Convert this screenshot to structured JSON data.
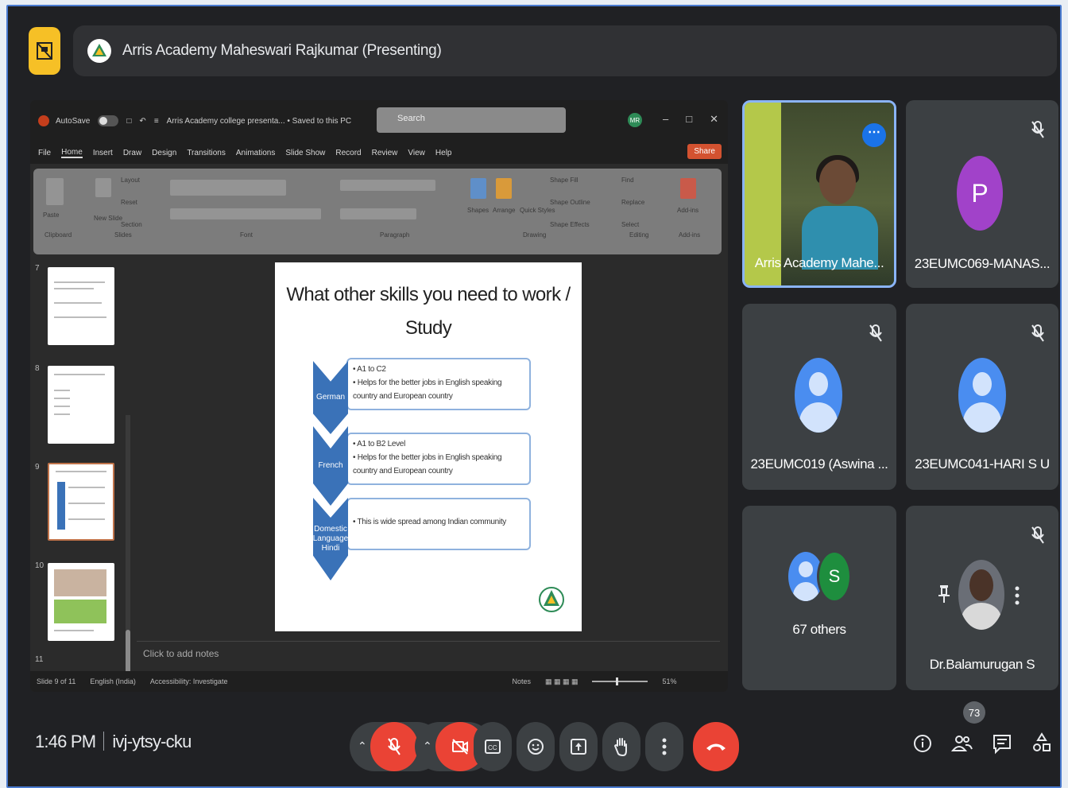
{
  "presenter": {
    "name": "Arris Academy Maheswari Rajkumar (Presenting)"
  },
  "powerpoint": {
    "autosave_label": "AutoSave",
    "autosave_state": "Off",
    "doc_title": "Arris Academy college presenta... • Saved to this PC",
    "search_placeholder": "Search",
    "user_initials": "MR",
    "menu_tabs": [
      "File",
      "Home",
      "Insert",
      "Draw",
      "Design",
      "Transitions",
      "Animations",
      "Slide Show",
      "Record",
      "Review",
      "View",
      "Help"
    ],
    "share_label": "Share",
    "ribbon_groups": [
      "Clipboard",
      "Slides",
      "Font",
      "Paragraph",
      "Drawing",
      "Editing",
      "Add-ins"
    ],
    "ribbon_items": {
      "layout": "Layout",
      "reset": "Reset",
      "section": "Section",
      "new_slide": "New Slide",
      "paste": "Paste",
      "shapes": "Shapes",
      "arrange": "Arrange",
      "quick_styles": "Quick Styles",
      "shape_fill": "Shape Fill",
      "shape_outline": "Shape Outline",
      "shape_effects": "Shape Effects",
      "find": "Find",
      "replace": "Replace",
      "select": "Select",
      "addins": "Add-ins"
    },
    "slide_numbers": [
      "7",
      "8",
      "9",
      "10",
      "11"
    ],
    "notes_placeholder": "Click to add notes",
    "status": {
      "slide_count": "Slide 9 of 11",
      "language": "English (India)",
      "accessibility": "Accessibility: Investigate",
      "notes": "Notes",
      "zoom": "51%"
    }
  },
  "slide": {
    "title": "What other skills you need to work / Study",
    "items": [
      {
        "label": "German",
        "bullets": [
          "A1 to C2",
          "Helps for the better jobs in English speaking country and European country"
        ]
      },
      {
        "label": "French",
        "bullets": [
          "A1 to B2 Level",
          "Helps for the better jobs in English speaking country and European country"
        ]
      },
      {
        "label": "Domestic Language Hindi",
        "bullets": [
          "This is wide spread among Indian community"
        ]
      }
    ]
  },
  "participants": {
    "tile1": {
      "name": "Arris Academy Mahe..."
    },
    "tile2": {
      "name": "23EUMC069-MANAS...",
      "initial": "P"
    },
    "tile3": {
      "name": "23EUMC019 (Aswina ..."
    },
    "tile4": {
      "name": "23EUMC041-HARI S U"
    },
    "tile5": {
      "name": "67 others",
      "initial": "S"
    },
    "tile6": {
      "name": "Dr.Balamurugan S"
    }
  },
  "meeting": {
    "time": "1:46 PM",
    "code": "ivj-ytsy-cku",
    "participant_count": "73"
  },
  "colors": {
    "meet_bg": "#202124",
    "tile_bg": "#3c4043",
    "end_call_red": "#ea4335",
    "active_blue": "#8ab4f8",
    "presenting_yellow": "#f6c026"
  },
  "icons": [
    "present-to-all-icon",
    "mic-off-icon",
    "camera-off-icon",
    "captions-icon",
    "emoji-icon",
    "present-screen-icon",
    "raise-hand-icon",
    "more-options-icon",
    "end-call-icon",
    "info-icon",
    "people-icon",
    "chat-icon",
    "activities-icon",
    "pin-icon"
  ]
}
